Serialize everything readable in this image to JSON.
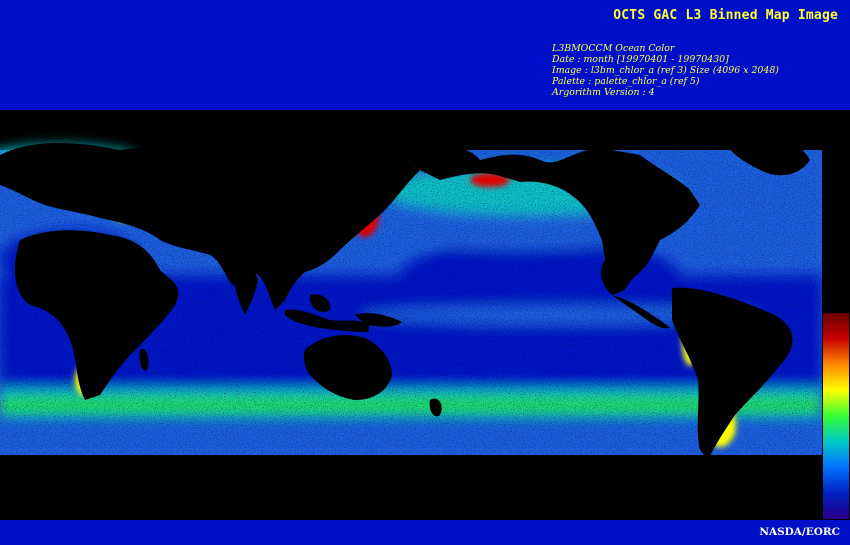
{
  "header": {
    "title": "OCTS GAC L3 Binned Map Image",
    "meta_lines": [
      "L3BMOCCM Ocean Color",
      "Date : month [19970401 - 19970430]",
      "Image : l3bm_chlor_a (ref 3) Size (4096 x 2048)",
      "Palette : palette_chlor_a (ref 5)",
      "Argorithm Version : 4"
    ]
  },
  "map": {
    "background_color": "#000000",
    "land_color": "#000000",
    "colorbar": {
      "stops": [
        "#6a0000",
        "#c80000",
        "#ff8800",
        "#ffff00",
        "#33ff33",
        "#00c8c8",
        "#0070ff",
        "#0020c0",
        "#280088"
      ]
    },
    "ocean_colors": {
      "deep": "#0018c8",
      "mid": "#1c60e0",
      "cyan": "#10c0c8",
      "green": "#20e040",
      "yellow": "#ffff00",
      "red": "#e00000",
      "darkred": "#800000"
    }
  },
  "footer": {
    "credit": "NASDA/EORC"
  }
}
